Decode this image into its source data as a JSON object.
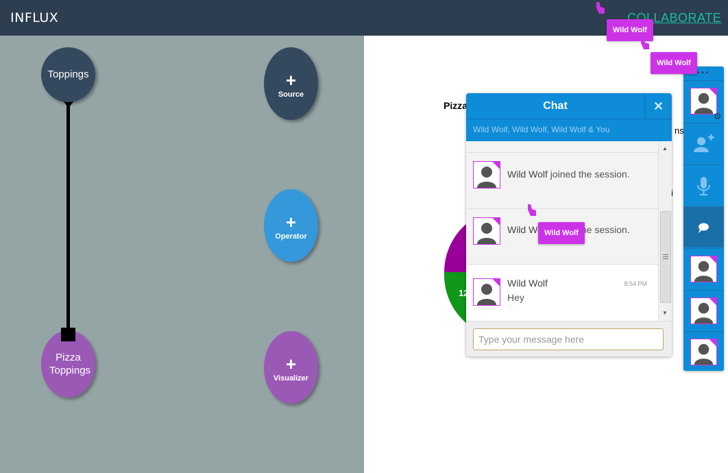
{
  "app": {
    "brand": "INFLUX",
    "collaborate_label": "COLLABORATE"
  },
  "canvas": {
    "nodes": [
      {
        "label": "Toppings"
      },
      {
        "plus": "+",
        "sub": "Source"
      },
      {
        "plus": "+",
        "sub": "Operator"
      },
      {
        "label": "Pizza Toppings"
      },
      {
        "plus": "+",
        "sub": "Visualizer"
      }
    ]
  },
  "visualization": {
    "title_fragment": "Pizza",
    "legend_fragment": "ns",
    "legend_fragment_2": "i",
    "pie_label_fragment": "12",
    "slice_colors": [
      "#990099",
      "#109618"
    ]
  },
  "chat": {
    "title": "Chat",
    "close_icon": "close-icon",
    "participants": "Wild Wolf, Wild Wolf, Wild Wolf & You",
    "messages": [
      {
        "name": "Wild Wolf",
        "text": " joined the session."
      },
      {
        "name": "Wild Wolf",
        "text": " joined the session."
      },
      {
        "name": "Wild Wolf",
        "text": "Hey",
        "time": "8:54 PM"
      }
    ],
    "input_placeholder": "Type your message here"
  },
  "sidebar": {
    "menu_dots": "•••"
  },
  "collaborator_tags": [
    "Wild Wolf",
    "Wild Wolf",
    "Wild Wolf"
  ],
  "colors": {
    "accent_purple": "#cc33e6",
    "chat_blue": "#0e8cd8",
    "topbar": "#2c3e50",
    "canvas_bg": "#95a5a6"
  }
}
